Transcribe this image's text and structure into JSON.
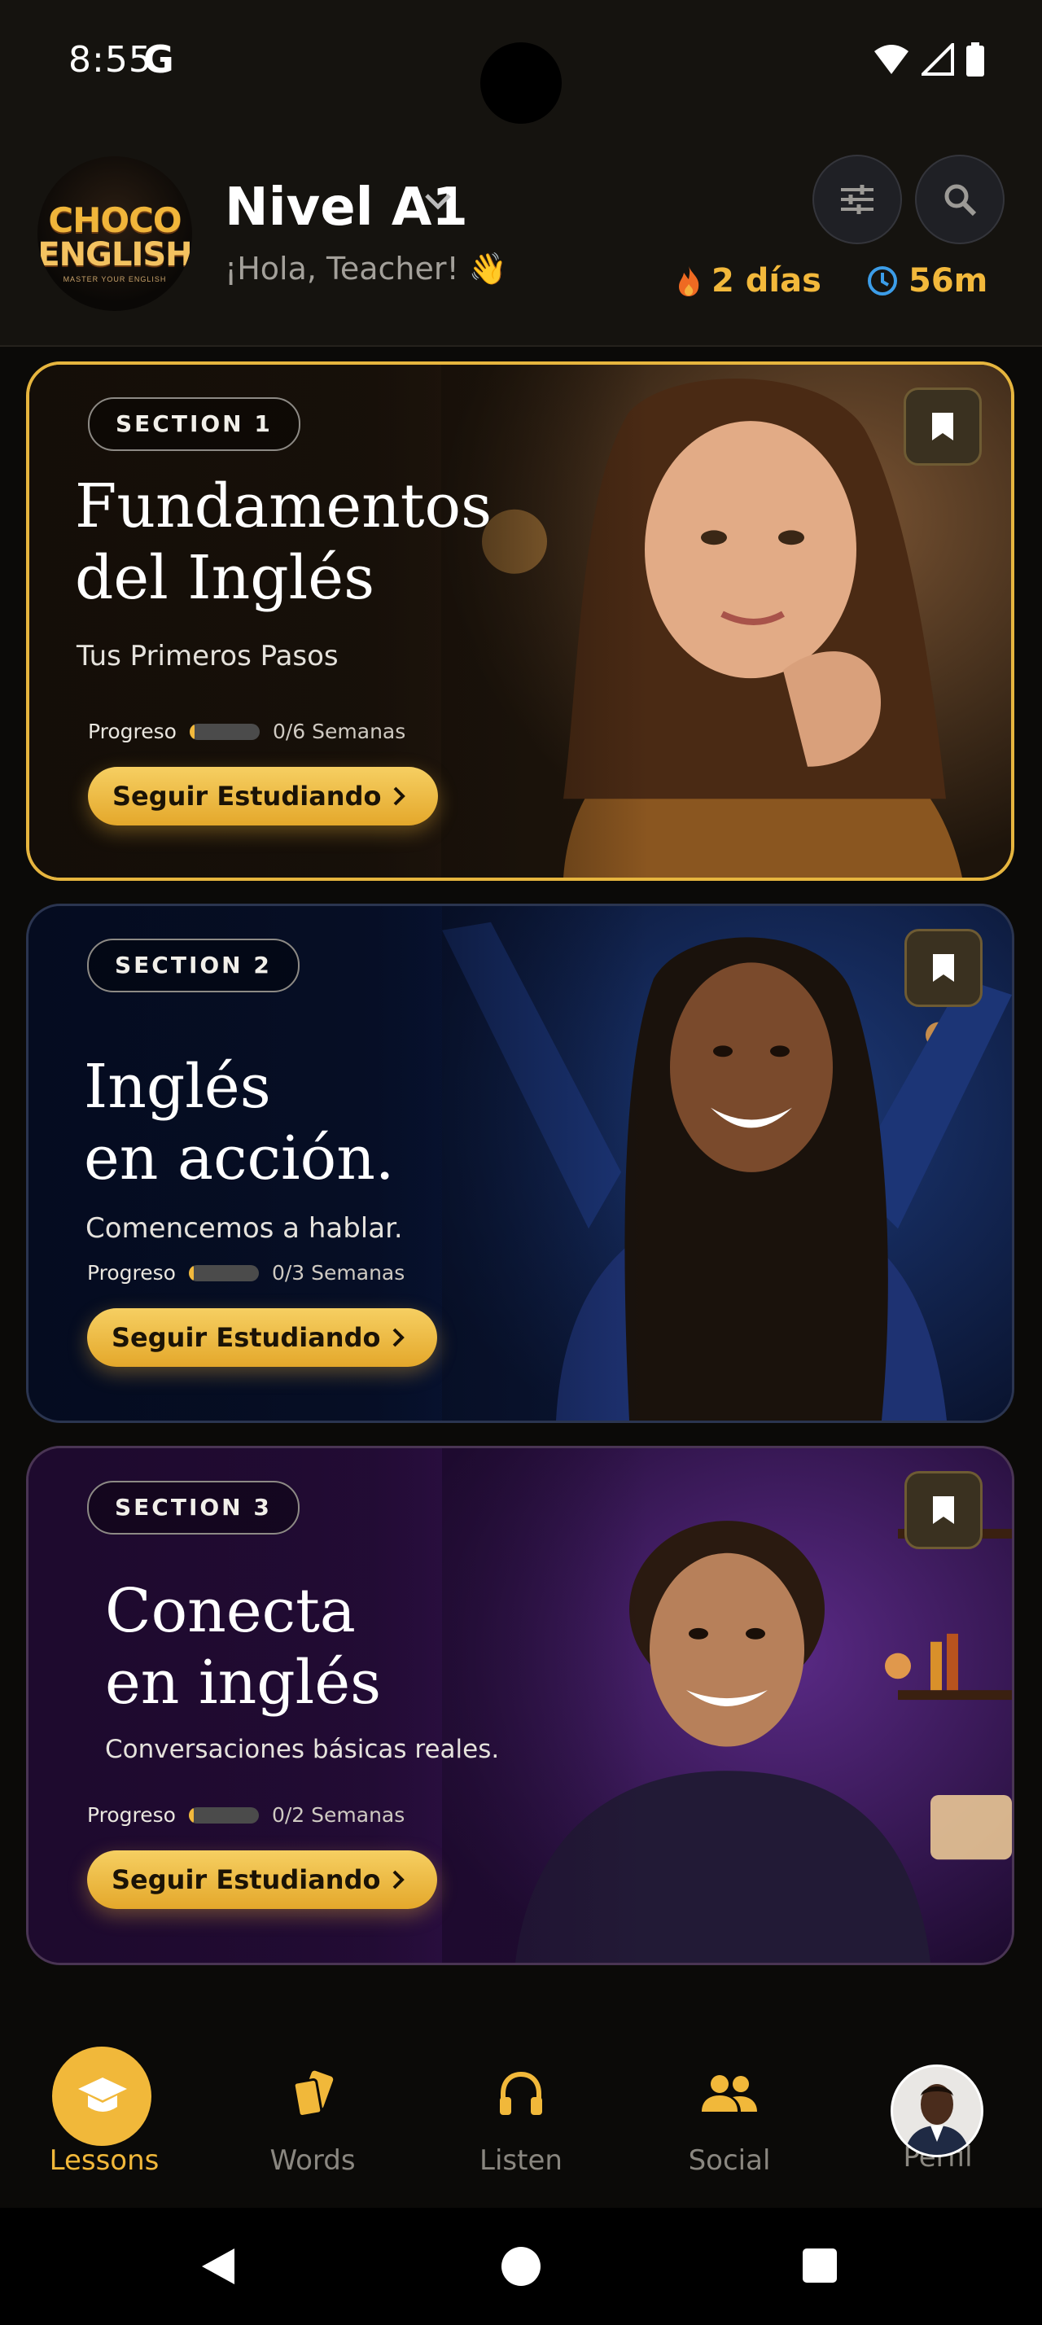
{
  "status_bar": {
    "time": "8:55",
    "google_letter": "G"
  },
  "header": {
    "logo": {
      "line1": "CHOCO",
      "line2": "ENGLISH",
      "tagline": "MASTER YOUR ENGLISH"
    },
    "level": "Nivel A1",
    "greeting": "¡Hola, Teacher! 👋",
    "streak": "2 días",
    "time_studied": "56m"
  },
  "cards": [
    {
      "badge": "SECTION 1",
      "title": "Fundamentos\ndel Inglés",
      "subtitle": "Tus Primeros Pasos",
      "progress_label": "Progreso",
      "progress_value": 0,
      "progress_text": "0/6 Semanas",
      "cta": "Seguir Estudiando"
    },
    {
      "badge": "SECTION 2",
      "title": "Inglés\nen acción.",
      "subtitle": "Comencemos a hablar.",
      "progress_label": "Progreso",
      "progress_value": 0,
      "progress_text": "0/3 Semanas",
      "cta": "Seguir Estudiando"
    },
    {
      "badge": "SECTION 3",
      "title": "Conecta\nen inglés",
      "subtitle": "Conversaciones básicas reales.",
      "progress_label": "Progreso",
      "progress_value": 0,
      "progress_text": "0/2 Semanas",
      "cta": "Seguir Estudiando"
    }
  ],
  "bottom_nav": [
    {
      "label": "Lessons",
      "icon": "graduation-cap-icon",
      "active": true
    },
    {
      "label": "Words",
      "icon": "cards-icon",
      "active": false
    },
    {
      "label": "Listen",
      "icon": "headphones-icon",
      "active": false
    },
    {
      "label": "Social",
      "icon": "people-icon",
      "active": false
    },
    {
      "label": "Perfil",
      "icon": "avatar",
      "active": false
    }
  ],
  "colors": {
    "accent": "#f1b83a",
    "background": "#0b0a08",
    "header": "#15130f"
  }
}
